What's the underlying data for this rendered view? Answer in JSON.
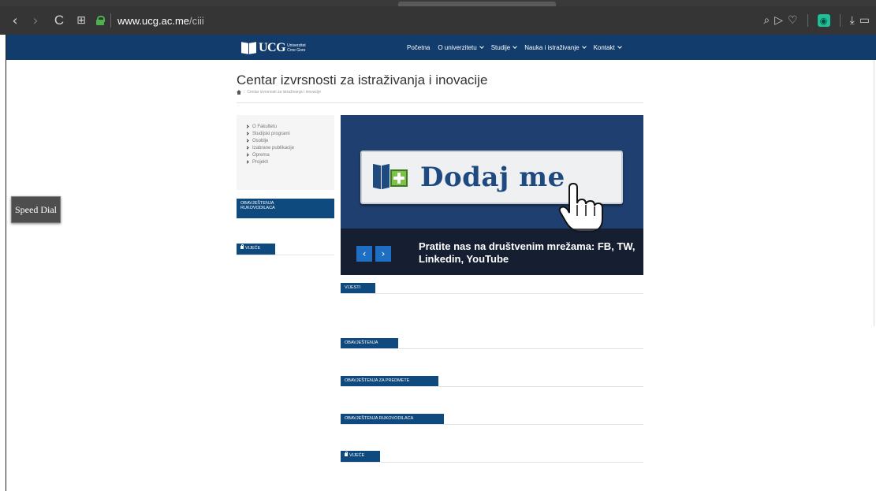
{
  "browser": {
    "url_host": "www.ucg.ac.me",
    "url_path": "/ciii",
    "nav": {
      "back": "‹",
      "forward": "›",
      "reload": "C",
      "grid": "⊞"
    },
    "tools": {
      "search": "⌕",
      "send": "▷",
      "heart": "♡",
      "ext": "◉",
      "download": "⤓",
      "battery": "▭"
    }
  },
  "site": {
    "logo_text": "UCG",
    "logo_sub": "Univerzitet Crne Gore",
    "menu": [
      {
        "label": "Početna",
        "has_dropdown": false
      },
      {
        "label": "O univerzitetu",
        "has_dropdown": true
      },
      {
        "label": "Studije",
        "has_dropdown": true
      },
      {
        "label": "Nauka i istraživanje",
        "has_dropdown": true
      },
      {
        "label": "Kontakt",
        "has_dropdown": true
      }
    ],
    "brand_color": "#123c6b"
  },
  "page": {
    "title": "Centar izvrsnosti za istraživanja i inovacije",
    "breadcrumb": "Centar izvrsnosti za istraživanja i inovacije"
  },
  "sidebar": {
    "items": [
      {
        "label": "O Fakultetu"
      },
      {
        "label": "Studijski programi"
      },
      {
        "label": "Osoblje"
      },
      {
        "label": "Izabrane publikacije"
      },
      {
        "label": "Oprema"
      },
      {
        "label": "Projekti"
      }
    ],
    "obavjestenja_tab_line1": "OBAVJEŠTENJA",
    "obavjestenja_tab_line2": "RUKOVODILACA",
    "vijece_tab": "VIJEĆE"
  },
  "banner": {
    "headline": "Dodaj me",
    "caption": "Pratite nas na društvenim mrežama: FB, TW, Linkedin, YouTube",
    "prev": "‹",
    "next": "›"
  },
  "sections": {
    "vijesti": "VIJESTI",
    "obavjestenja": "OBAVJEŠTENJA",
    "obavjestenja_predmete": "OBAVJEŠTENJA ZA PREDMETE",
    "obavjestenja_rukovodilaca": "OBAVJEŠTENJA RUKOVODILACA",
    "vijece": "VIJEĆE"
  },
  "speed_dial": "Speed Dial"
}
